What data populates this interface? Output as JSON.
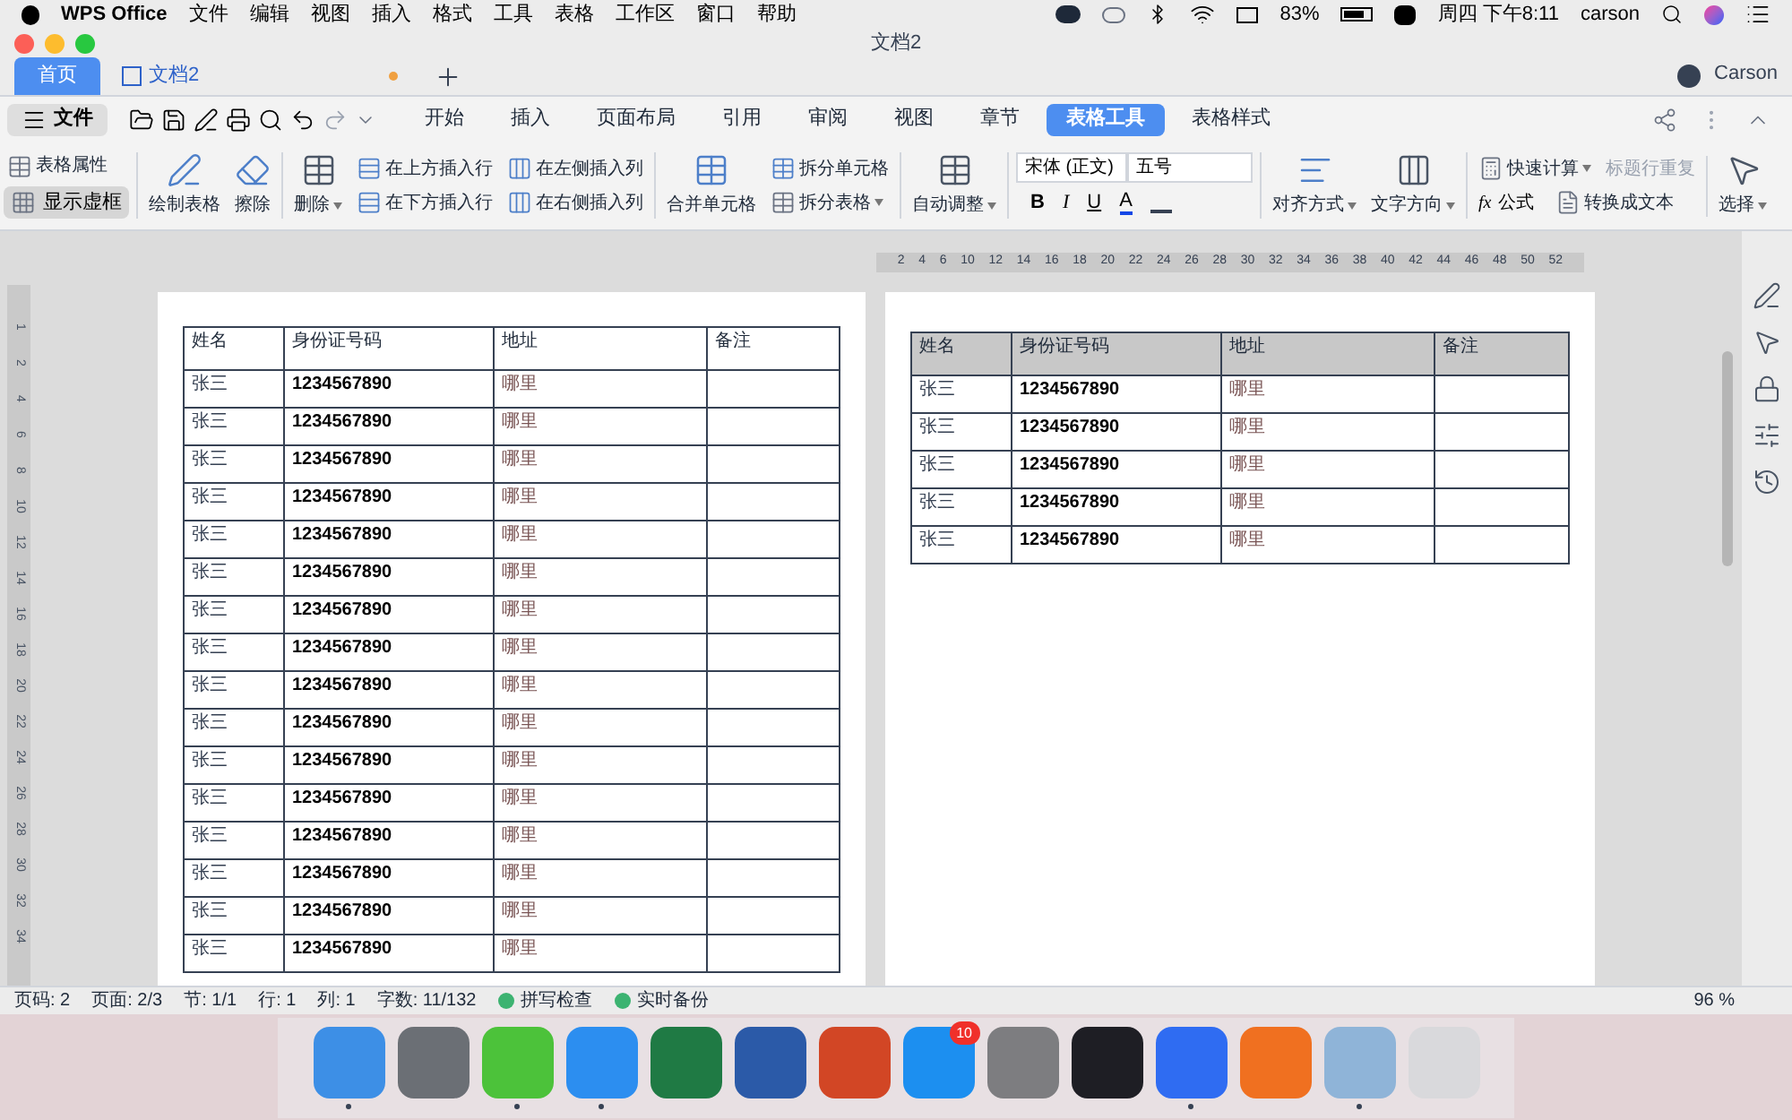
{
  "menu_bar": {
    "app": "WPS Office",
    "items": [
      "文件",
      "编辑",
      "视图",
      "插入",
      "格式",
      "工具",
      "表格",
      "工作区",
      "窗口",
      "帮助"
    ],
    "battery": "83%",
    "clock": "周四 下午8:11",
    "user": "carson"
  },
  "window": {
    "title": "文档2"
  },
  "tabs": [
    {
      "label": "首页",
      "kind": "home",
      "selected": true
    },
    {
      "label": "文档2",
      "kind": "doc",
      "selected": false,
      "unsaved": true
    }
  ],
  "account": "Carson",
  "file_menu": "文件",
  "ribbon_tabs": [
    {
      "label": "开始",
      "selected": false
    },
    {
      "label": "插入",
      "selected": false
    },
    {
      "label": "页面布局",
      "selected": false
    },
    {
      "label": "引用",
      "selected": false
    },
    {
      "label": "审阅",
      "selected": false
    },
    {
      "label": "视图",
      "selected": false
    },
    {
      "label": "章节",
      "selected": false
    },
    {
      "label": "表格工具",
      "selected": true
    },
    {
      "label": "表格样式",
      "selected": false
    }
  ],
  "ribbon": {
    "table_properties": "表格属性",
    "show_gridlines": {
      "label": "显示虚框",
      "on": true
    },
    "draw_table": "绘制表格",
    "erase": "擦除",
    "delete": "删除",
    "insert_above": "在上方插入行",
    "insert_below": "在下方插入行",
    "insert_left": "在左侧插入列",
    "insert_right": "在右侧插入列",
    "merge": "合并单元格",
    "split_cells": "拆分单元格",
    "split_table": "拆分表格",
    "autofit": "自动调整",
    "font": "宋体 (正文)",
    "size": "五号",
    "bold": "B",
    "italic": "I",
    "underline": "U",
    "font_color": "A",
    "align": "对齐方式",
    "direction": "文字方向",
    "quick_calc": "快速计算",
    "repeat_header": {
      "label": "标题行重复",
      "disabled": true
    },
    "formula_sign": "fx",
    "formula": "公式",
    "to_text": "转换成文本",
    "select": "选择"
  },
  "ruler": [
    "2",
    "4",
    "6",
    "10",
    "12",
    "14",
    "16",
    "18",
    "20",
    "22",
    "24",
    "26",
    "28",
    "30",
    "32",
    "34",
    "36",
    "38",
    "40",
    "42",
    "44",
    "46",
    "48",
    "50",
    "52"
  ],
  "vertical_ruler": [
    "1",
    "2",
    "4",
    "6",
    "8",
    "10",
    "12",
    "14",
    "16",
    "18",
    "20",
    "22",
    "24",
    "26",
    "28",
    "30",
    "32",
    "34"
  ],
  "left_table": {
    "columns": [
      "姓名",
      "身份证号码",
      "地址",
      "备注"
    ],
    "rows": [
      [
        "张三",
        "1234567890",
        "哪里"
      ],
      [
        "张三",
        "1234567890",
        "哪里"
      ],
      [
        "张三",
        "1234567890",
        "哪里"
      ],
      [
        "张三",
        "1234567890",
        "哪里"
      ],
      [
        "张三",
        "1234567890",
        "哪里"
      ],
      [
        "张三",
        "1234567890",
        "哪里"
      ],
      [
        "张三",
        "1234567890",
        "哪里"
      ],
      [
        "张三",
        "1234567890",
        "哪里"
      ],
      [
        "张三",
        "1234567890",
        "哪里"
      ],
      [
        "张三",
        "1234567890",
        "哪里"
      ],
      [
        "张三",
        "1234567890",
        "哪里"
      ],
      [
        "张三",
        "1234567890",
        "哪里"
      ],
      [
        "张三",
        "1234567890",
        "哪里"
      ],
      [
        "张三",
        "1234567890",
        "哪里"
      ],
      [
        "张三",
        "1234567890",
        "哪里"
      ],
      [
        "张三",
        "1234567890",
        "哪里"
      ]
    ]
  },
  "right_table": {
    "header_shaded": true,
    "columns": [
      "姓名",
      "身份证号码",
      "地址",
      "备注"
    ],
    "rows": [
      [
        "张三",
        "1234567890",
        "哪里"
      ],
      [
        "张三",
        "1234567890",
        "哪里"
      ],
      [
        "张三",
        "1234567890",
        "哪里"
      ],
      [
        "张三",
        "1234567890",
        "哪里"
      ],
      [
        "张三",
        "1234567890",
        "哪里"
      ]
    ]
  },
  "status_bar": {
    "items": [
      "页码: 2",
      "页面: 2/3",
      "节: 1/1",
      "行: 1",
      "列: 1",
      "字数: 11/132"
    ],
    "toggles": [
      {
        "label": "拼写检查",
        "on": true
      },
      {
        "label": "实时备份",
        "on": true
      }
    ],
    "zoom": "96 %"
  },
  "dock": [
    {
      "kind": "finder",
      "running": true
    },
    {
      "kind": "launchpad",
      "running": false
    },
    {
      "kind": "wechat",
      "running": true
    },
    {
      "kind": "safari",
      "running": true
    },
    {
      "kind": "excel",
      "running": false
    },
    {
      "kind": "word",
      "running": false
    },
    {
      "kind": "powerpoint",
      "running": false
    },
    {
      "kind": "appstore",
      "running": false,
      "badge": "10"
    },
    {
      "kind": "preferences",
      "running": false
    },
    {
      "kind": "intellij",
      "running": false
    },
    {
      "kind": "wps",
      "running": true
    },
    {
      "kind": "firefox",
      "running": false
    },
    {
      "kind": "preview",
      "running": true
    },
    {
      "kind": "trash",
      "running": false
    }
  ]
}
